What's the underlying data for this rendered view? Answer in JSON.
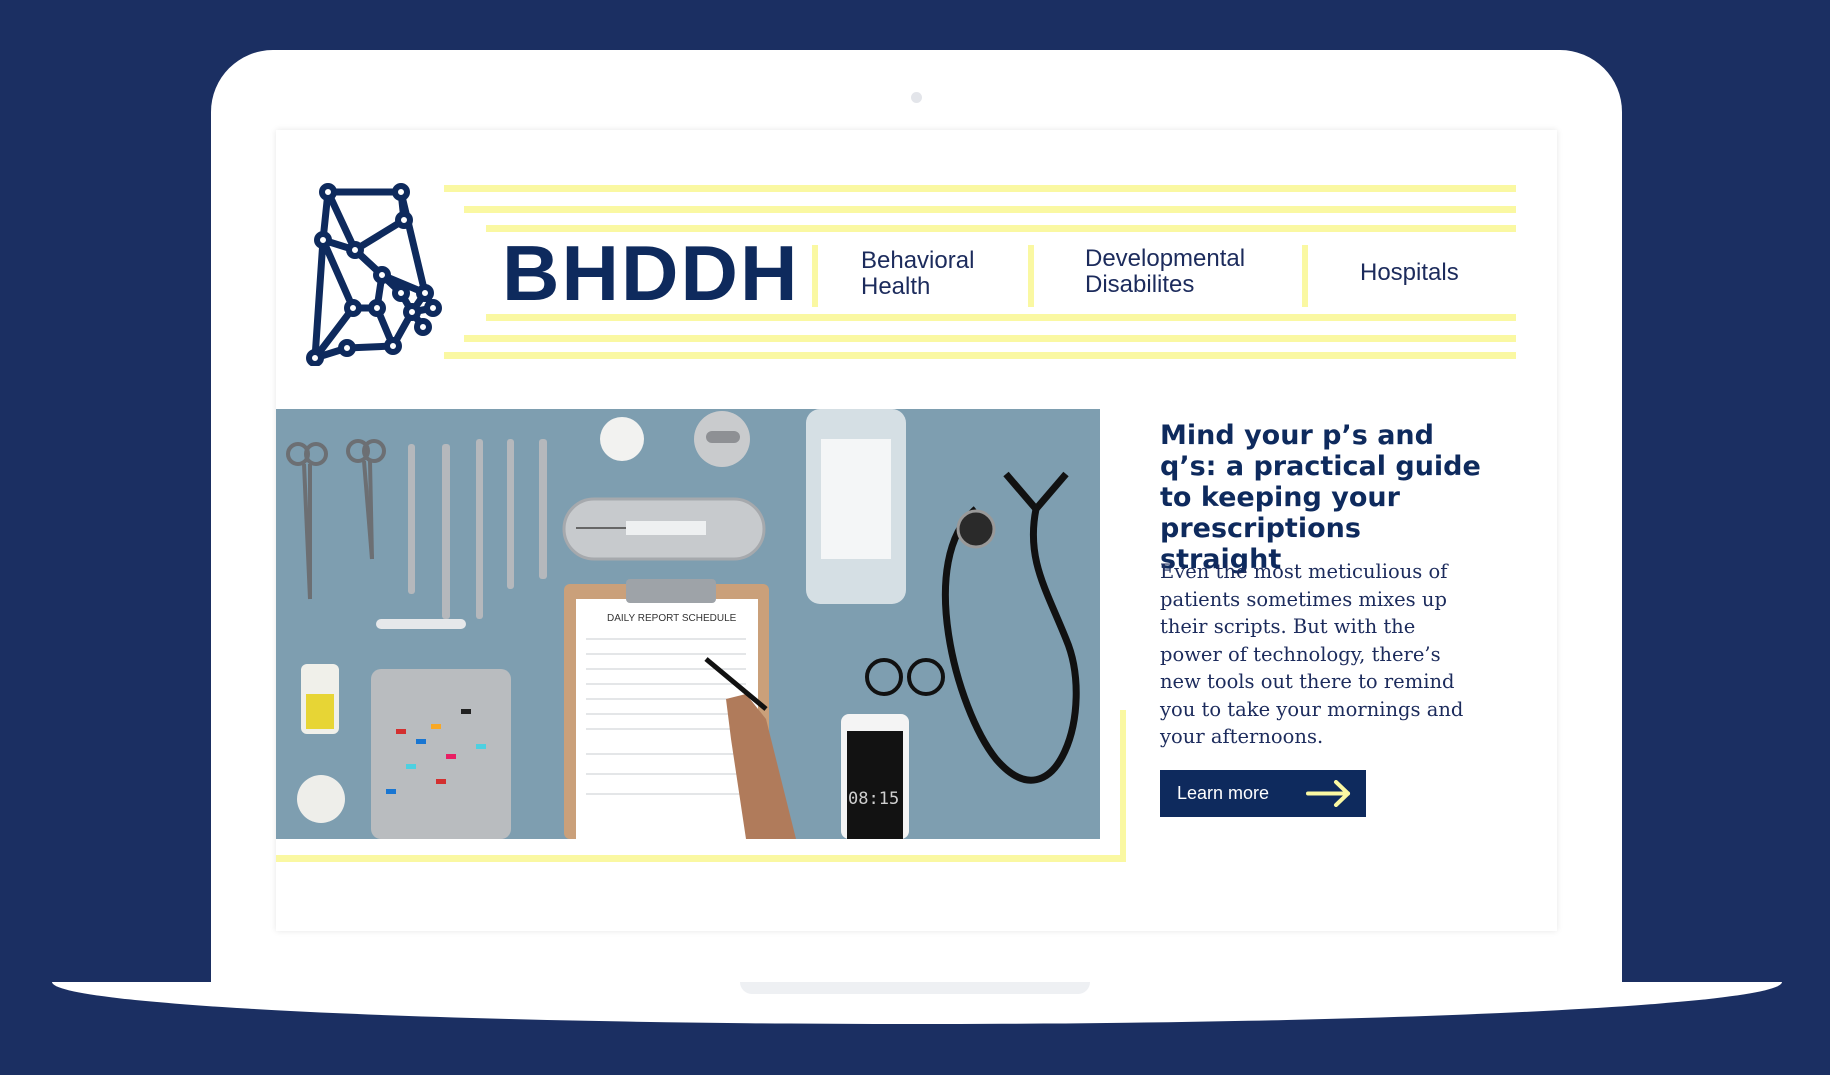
{
  "colors": {
    "background": "#1b2f62",
    "brand_navy": "#0e2a5d",
    "accent_yellow": "#faf8a2",
    "laptop": "#ffffff"
  },
  "header": {
    "brand": "BHDDH",
    "logo_icon": "network-map-icon",
    "nav": [
      {
        "line1": "Behavioral",
        "line2": "Health"
      },
      {
        "line1": "Developmental",
        "line2": "Disabilites"
      },
      {
        "line1": "Hospitals",
        "line2": ""
      }
    ]
  },
  "feature": {
    "image_label": "medical-supplies-photo",
    "photo_sheet_title": "DAILY REPORT SCHEDULE",
    "photo_clock": "08:15",
    "headline": "Mind your p’s and q’s: a practical guide to keeping your prescriptions straight",
    "body": "Even the most meticulious of patients sometimes mixes up their scripts. But with the power of technology, there’s new tools out there to remind you to take your mornings and your afternoons.",
    "cta_label": "Learn more",
    "cta_icon": "arrow-right-icon"
  }
}
